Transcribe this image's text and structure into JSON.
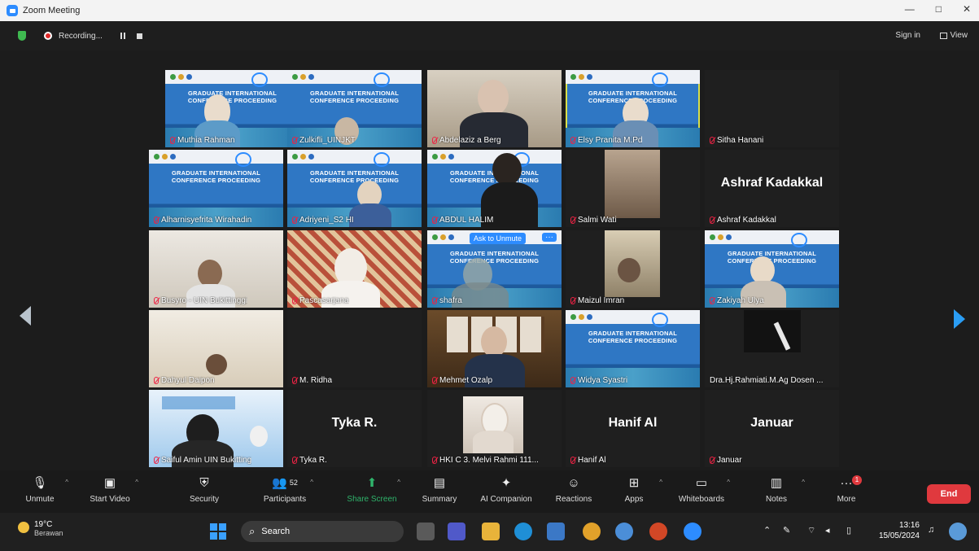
{
  "window": {
    "title": "Zoom Meeting",
    "minimize": "—",
    "restore": "□",
    "close": "✕"
  },
  "topbar": {
    "recording": "Recording...",
    "sign_in": "Sign in",
    "view": "View"
  },
  "banner": {
    "title_line1": "GRADUATE INTERNATIONAL",
    "title_line2": "CONFERENCE PROCEEDING"
  },
  "tiles": [
    {
      "name": "Muthia Rahman",
      "big": ""
    },
    {
      "name": "Zulkifli_UINJKT",
      "big": ""
    },
    {
      "name": "Abdelaziz a Berg",
      "big": ""
    },
    {
      "name": "Elsy Pranita M.Pd",
      "big": ""
    },
    {
      "name": "Sitha Hanani",
      "big": ""
    },
    {
      "name": "Alharnisyefrita Wirahadin",
      "big": ""
    },
    {
      "name": "Adriyeni_S2 HI",
      "big": ""
    },
    {
      "name": "ABDUL HALIM",
      "big": ""
    },
    {
      "name": "Salmi Wati",
      "big": ""
    },
    {
      "name": "Ashraf Kadakkal",
      "big": "Ashraf Kadakkal"
    },
    {
      "name": "Busyro - UIN Bukittinggi",
      "big": ""
    },
    {
      "name": "Pascasarjana",
      "big": ""
    },
    {
      "name": "shafra",
      "big": "",
      "tag": "Ask to Unmute",
      "more": "···"
    },
    {
      "name": "Maizul Imran",
      "big": ""
    },
    {
      "name": "Zakiyah Ulya",
      "big": ""
    },
    {
      "name": "Dahyul Daipon",
      "big": ""
    },
    {
      "name": "M. Ridha",
      "big": ""
    },
    {
      "name": "Mehmet Ozalp",
      "big": ""
    },
    {
      "name": "Widya Syastri",
      "big": ""
    },
    {
      "name": "Dra.Hj.Rahmiati.M.Ag Dosen ...",
      "big": ""
    },
    {
      "name": "Saiful Amin UIN Bukitting",
      "big": ""
    },
    {
      "name": "Tyka R.",
      "big": "Tyka R."
    },
    {
      "name": "HKI C 3. Melvi Rahmi 111...",
      "big": ""
    },
    {
      "name": "Hanif Al",
      "big": "Hanif Al"
    },
    {
      "name": "Januar",
      "big": "Januar"
    }
  ],
  "toolbar": {
    "unmute": "Unmute",
    "start_video": "Start Video",
    "security": "Security",
    "participants": "Participants",
    "participants_count": "52",
    "share_screen": "Share Screen",
    "summary": "Summary",
    "ai_companion": "AI Companion",
    "reactions": "Reactions",
    "apps": "Apps",
    "whiteboards": "Whiteboards",
    "notes": "Notes",
    "more": "More",
    "more_badge": "1",
    "end": "End"
  },
  "taskbar": {
    "temp": "19°C",
    "weather": "Berawan",
    "search": "Search",
    "time": "13:16",
    "date": "15/05/2024"
  },
  "colors": {
    "accent": "#2d8cff",
    "end": "#e0393e",
    "share": "#2fb36b"
  }
}
